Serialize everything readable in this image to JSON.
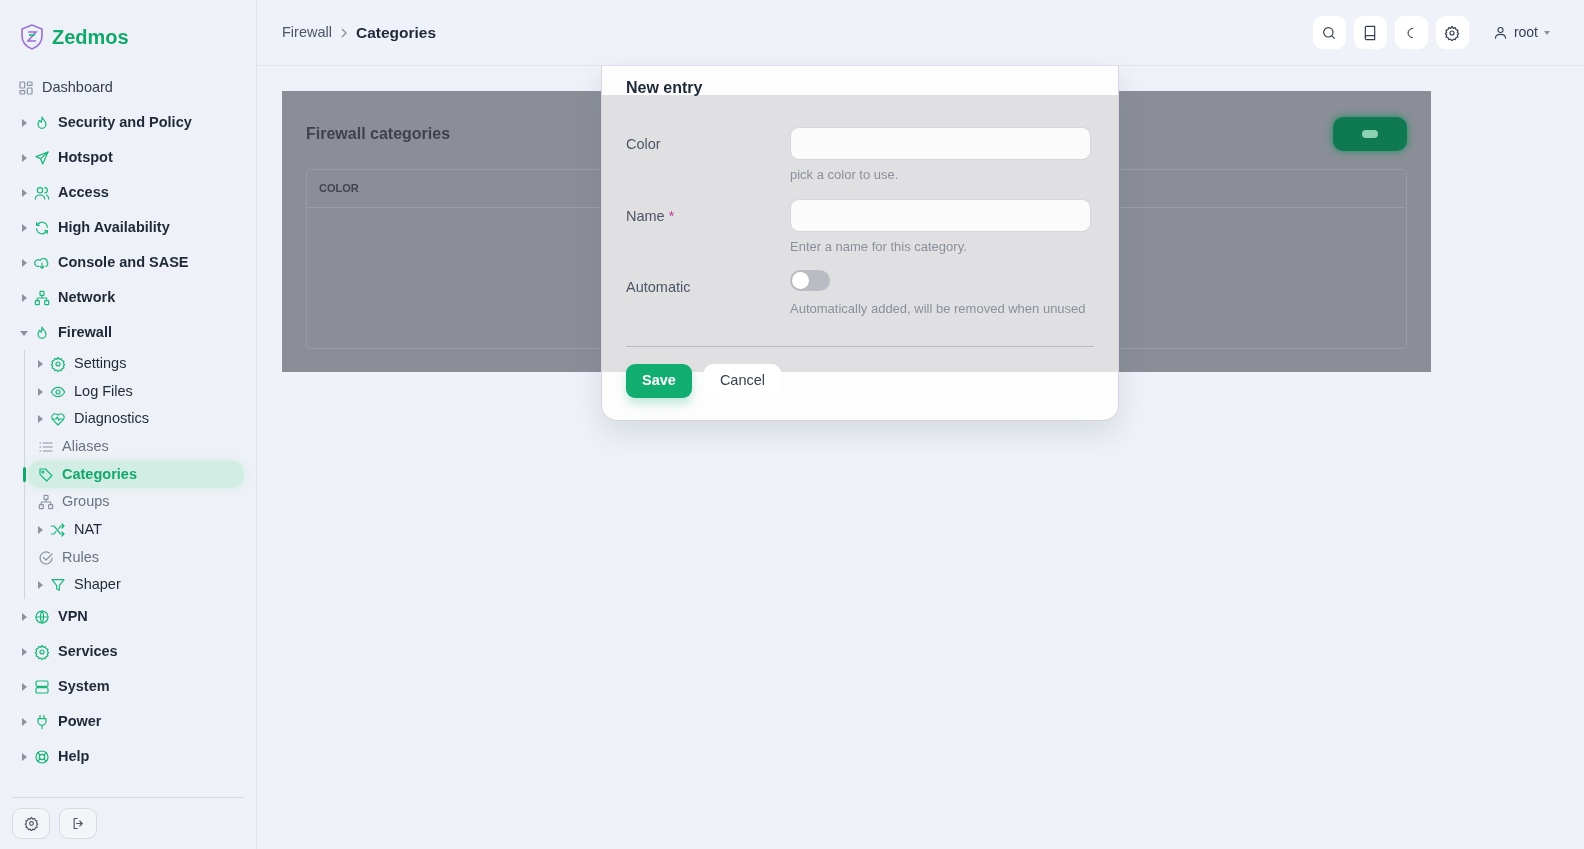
{
  "brand": "Zedmos",
  "menu": [
    {
      "label": "Dashboard",
      "kind": "leaf",
      "selected": false
    },
    {
      "label": "Security and Policy",
      "kind": "group",
      "expanded": false
    },
    {
      "label": "Hotspot",
      "kind": "group",
      "expanded": false
    },
    {
      "label": "Access",
      "kind": "group",
      "expanded": false
    },
    {
      "label": "High Availability",
      "kind": "group",
      "expanded": false
    },
    {
      "label": "Console and SASE",
      "kind": "group",
      "expanded": false
    },
    {
      "label": "Network",
      "kind": "group",
      "expanded": false
    },
    {
      "label": "Firewall",
      "kind": "group",
      "expanded": true,
      "children": [
        {
          "label": "Settings",
          "kind": "group",
          "expanded": false
        },
        {
          "label": "Log Files",
          "kind": "group",
          "expanded": false
        },
        {
          "label": "Diagnostics",
          "kind": "group",
          "expanded": false
        },
        {
          "label": "Aliases",
          "kind": "leaf",
          "selected": false
        },
        {
          "label": "Categories",
          "kind": "leaf",
          "selected": true
        },
        {
          "label": "Groups",
          "kind": "leaf",
          "selected": false
        },
        {
          "label": "NAT",
          "kind": "group",
          "expanded": false
        },
        {
          "label": "Rules",
          "kind": "leaf",
          "selected": false
        },
        {
          "label": "Shaper",
          "kind": "group",
          "expanded": false
        }
      ]
    },
    {
      "label": "VPN",
      "kind": "group",
      "expanded": false
    },
    {
      "label": "Services",
      "kind": "group",
      "expanded": false
    },
    {
      "label": "System",
      "kind": "group",
      "expanded": false
    },
    {
      "label": "Power",
      "kind": "group",
      "expanded": false
    },
    {
      "label": "Help",
      "kind": "group",
      "expanded": false
    }
  ],
  "breadcrumb": [
    "Firewall",
    "Categories"
  ],
  "user": "root",
  "card": {
    "title": "Firewall categories",
    "columns": [
      "COLOR"
    ]
  },
  "dialog": {
    "title": "New entry",
    "fields": [
      {
        "kind": "text",
        "label": "Color",
        "help": "pick a color to use."
      },
      {
        "kind": "text",
        "label": "Name",
        "required_mark": "*",
        "help": "Enter a name for this category."
      },
      {
        "kind": "switch",
        "label": "Automatic",
        "on": false,
        "help": "Automatically added, will be removed when unused"
      }
    ],
    "buttons": [
      {
        "label": "Save",
        "kind": "primary"
      },
      {
        "label": "Cancel",
        "kind": "secondary"
      }
    ]
  }
}
